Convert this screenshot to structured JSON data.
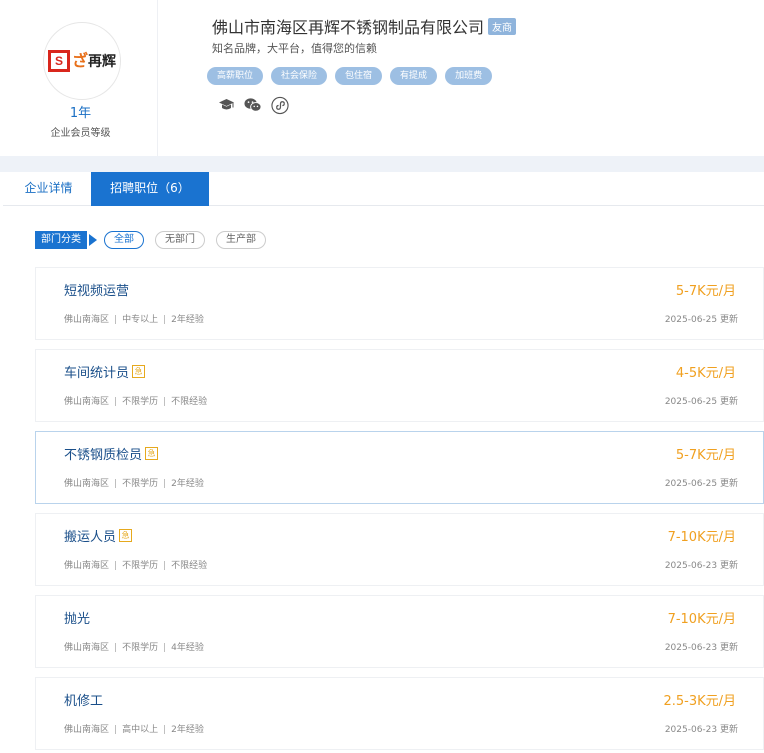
{
  "company": {
    "logo_text": "再辉",
    "logo_square": "S",
    "membership_years": "1年",
    "membership_label": "企业会员等级",
    "name": "佛山市南海区再辉不锈钢制品有限公司",
    "badge": "友商",
    "slogan": "知名品牌，大平台，值得您的信赖",
    "benefit_tags": [
      "高薪职位",
      "社会保险",
      "包住宿",
      "有提成",
      "加班费"
    ],
    "icons": [
      "graduation-cap-icon",
      "wechat-icon",
      "miniprogram-icon"
    ]
  },
  "tabs": [
    {
      "label": "企业详情",
      "active": false
    },
    {
      "label": "招聘职位（6）",
      "active": true
    }
  ],
  "departments": {
    "label": "部门分类",
    "options": [
      {
        "label": "全部",
        "active": true
      },
      {
        "label": "无部门",
        "active": false
      },
      {
        "label": "生产部",
        "active": false
      }
    ]
  },
  "jobs": [
    {
      "title": "短视频运营",
      "urgent": false,
      "location": "佛山南海区",
      "education": "中专以上",
      "experience": "2年经验",
      "salary": "5-7K元/月",
      "updated": "2025-06-25 更新"
    },
    {
      "title": "车间统计员",
      "urgent": true,
      "urgent_label": "急",
      "location": "佛山南海区",
      "education": "不限学历",
      "experience": "不限经验",
      "salary": "4-5K元/月",
      "updated": "2025-06-25 更新"
    },
    {
      "title": "不锈钢质检员",
      "urgent": true,
      "urgent_label": "急",
      "location": "佛山南海区",
      "education": "不限学历",
      "experience": "2年经验",
      "salary": "5-7K元/月",
      "updated": "2025-06-25 更新"
    },
    {
      "title": "搬运人员",
      "urgent": true,
      "urgent_label": "急",
      "location": "佛山南海区",
      "education": "不限学历",
      "experience": "不限经验",
      "salary": "7-10K元/月",
      "updated": "2025-06-23 更新"
    },
    {
      "title": "抛光",
      "urgent": false,
      "location": "佛山南海区",
      "education": "不限学历",
      "experience": "4年经验",
      "salary": "7-10K元/月",
      "updated": "2025-06-23 更新"
    },
    {
      "title": "机修工",
      "urgent": false,
      "location": "佛山南海区",
      "education": "高中以上",
      "experience": "2年经验",
      "salary": "2.5-3K元/月",
      "updated": "2025-06-23 更新"
    }
  ],
  "colors": {
    "accent": "#1a73d0",
    "salary": "#f0a020",
    "tag": "#9dbfe3"
  }
}
